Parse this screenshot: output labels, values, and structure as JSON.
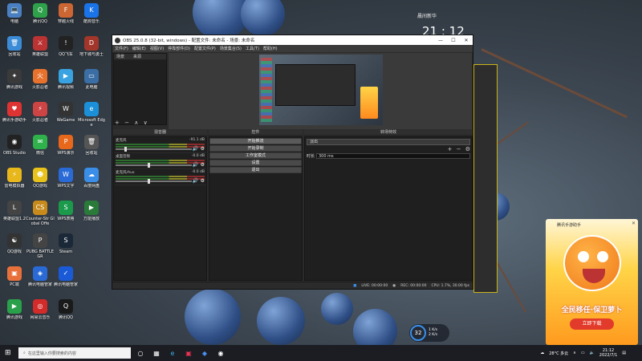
{
  "desktop": {
    "icons": [
      {
        "label": "电脑",
        "col": 0,
        "row": 0,
        "color": "#4a7fc1",
        "glyph": "💻"
      },
      {
        "label": "腾讯QQ",
        "col": 1,
        "row": 0,
        "color": "#2ea14a",
        "glyph": "Q"
      },
      {
        "label": "穿越火线",
        "col": 2,
        "row": 0,
        "color": "#c63",
        "glyph": "F"
      },
      {
        "label": "酷狗音乐",
        "col": 3,
        "row": 0,
        "color": "#1a73e8",
        "glyph": "K"
      },
      {
        "label": "回收站",
        "col": 0,
        "row": 1,
        "color": "#3b8bd6",
        "glyph": "🗑"
      },
      {
        "label": "英雄联盟",
        "col": 1,
        "row": 1,
        "color": "#b33",
        "glyph": "⚔"
      },
      {
        "label": "QQ飞车",
        "col": 2,
        "row": 1,
        "color": "#222",
        "glyph": "!"
      },
      {
        "label": "地下城与勇士",
        "col": 3,
        "row": 1,
        "color": "#a3362a",
        "glyph": "D"
      },
      {
        "label": "腾讯游戏",
        "col": 0,
        "row": 2,
        "color": "#3a3a3a",
        "glyph": "✦"
      },
      {
        "label": "火影忍者",
        "col": 1,
        "row": 2,
        "color": "#e8712c",
        "glyph": "火"
      },
      {
        "label": "腾讯视频",
        "col": 2,
        "row": 2,
        "color": "#38a3e0",
        "glyph": "▶"
      },
      {
        "label": "此电脑",
        "col": 3,
        "row": 2,
        "color": "#3a6ea5",
        "glyph": "▭"
      },
      {
        "label": "腾讯手游助手",
        "col": 0,
        "row": 3,
        "color": "#d33",
        "glyph": "♥"
      },
      {
        "label": "火影忍者",
        "col": 1,
        "row": 3,
        "color": "#c44",
        "glyph": "⚡"
      },
      {
        "label": "WeGame",
        "col": 2,
        "row": 3,
        "color": "#333",
        "glyph": "W"
      },
      {
        "label": "Microsoft Edge",
        "col": 3,
        "row": 3,
        "color": "#1b8fd8",
        "glyph": "e"
      },
      {
        "label": "OBS Studio",
        "col": 0,
        "row": 4,
        "color": "#222",
        "glyph": "◉"
      },
      {
        "label": "微信",
        "col": 1,
        "row": 4,
        "color": "#2fb24c",
        "glyph": "✉"
      },
      {
        "label": "WPS演示",
        "col": 2,
        "row": 4,
        "color": "#e8681b",
        "glyph": "P"
      },
      {
        "label": "回收站",
        "col": 3,
        "row": 4,
        "color": "#555",
        "glyph": "🗑"
      },
      {
        "label": "雷电模拟器",
        "col": 0,
        "row": 5,
        "color": "#e8b71b",
        "glyph": "⚡"
      },
      {
        "label": "QQ游戏",
        "col": 1,
        "row": 5,
        "color": "#e8c21b",
        "glyph": "☻"
      },
      {
        "label": "WPS文字",
        "col": 2,
        "row": 5,
        "color": "#2a6ad6",
        "glyph": "W"
      },
      {
        "label": "百度网盘",
        "col": 3,
        "row": 5,
        "color": "#3a8ee8",
        "glyph": "☁"
      },
      {
        "label": "英雄联盟1.2",
        "col": 0,
        "row": 6,
        "color": "#444",
        "glyph": "L"
      },
      {
        "label": "Counter-Str Global Offe",
        "col": 1,
        "row": 6,
        "color": "#c78a1b",
        "glyph": "CS"
      },
      {
        "label": "WPS表格",
        "col": 2,
        "row": 6,
        "color": "#1a9a4a",
        "glyph": "S"
      },
      {
        "label": "万能播放",
        "col": 3,
        "row": 6,
        "color": "#2a7a3a",
        "glyph": "▶"
      },
      {
        "label": "QQ游戏",
        "col": 0,
        "row": 7,
        "color": "#333",
        "glyph": "☯"
      },
      {
        "label": "PUBG BATTLEGR",
        "col": 1,
        "row": 7,
        "color": "#444",
        "glyph": "P"
      },
      {
        "label": "Steam",
        "col": 2,
        "row": 7,
        "color": "#1b2838",
        "glyph": "S"
      },
      {
        "label": "PC端",
        "col": 0,
        "row": 8,
        "color": "#e8713b",
        "glyph": "▣"
      },
      {
        "label": "腾讯电脑管家",
        "col": 1,
        "row": 8,
        "color": "#2a6ad6",
        "glyph": "◈"
      },
      {
        "label": "腾讯电脑管家",
        "col": 2,
        "row": 8,
        "color": "#1a5ad6",
        "glyph": "✓"
      },
      {
        "label": "腾讯游戏",
        "col": 0,
        "row": 9,
        "color": "#2aa04a",
        "glyph": "▶"
      },
      {
        "label": "网易云音乐",
        "col": 1,
        "row": 9,
        "color": "#d32a2a",
        "glyph": "◎"
      },
      {
        "label": "腾讯QQ",
        "col": 2,
        "row": 9,
        "color": "#1a1a1a",
        "glyph": "Q"
      }
    ]
  },
  "clock": {
    "label": "晨间新华",
    "time": "21 : 12"
  },
  "obs": {
    "title": "OBS 25.0.8 (32-bit, windows) - 配置文件: 未命名 - 场景: 未命名",
    "menu": [
      "文件(F)",
      "编辑(E)",
      "视图(V)",
      "停靠部件(D)",
      "配置文件(P)",
      "场景集合(S)",
      "工具(T)",
      "帮助(H)"
    ],
    "scenes_title": "场景",
    "scene_item": "场景",
    "sources_title": "来源",
    "mixer_title": "混音器",
    "mixer_channels": [
      {
        "name": "麦克风",
        "db": "-91.1 dB",
        "level": 0.12
      },
      {
        "name": "桌面音频",
        "db": "-0.0 dB",
        "level": 0.42
      },
      {
        "name": "麦克风/Aux",
        "db": "-0.0 dB",
        "level": 0.42
      }
    ],
    "controls_title": "控件",
    "controls": [
      "开始推流",
      "开始录制",
      "工作室模式",
      "设置",
      "退出"
    ],
    "transitions_title": "转场特效",
    "transition_value": "淡出",
    "duration_label": "时长",
    "duration_value": "300 ms",
    "status": {
      "live": "LIVE: 00:00:00",
      "rec": "REC: 00:00:00",
      "cpu": "CPU: 1.7%, 30.00 fps"
    }
  },
  "ad": {
    "brand": "腾讯手游助手",
    "slogan": "全民移任·保卫萝卜",
    "button": "立即下载"
  },
  "taskbar": {
    "search_placeholder": "在这里输入你要搜索的内容",
    "temp": "28°C 多云",
    "tray_time": "21:12",
    "tray_date": "2022/7/1"
  },
  "float_meter": {
    "value": "32",
    "up": "1 K/s",
    "down": "2 K/s"
  }
}
